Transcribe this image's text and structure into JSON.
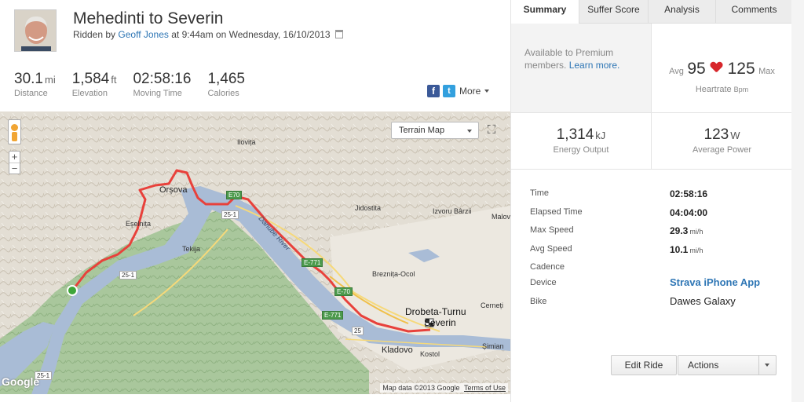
{
  "activity": {
    "title": "Mehedinti to Severin",
    "ridden_by_prefix": "Ridden by",
    "athlete_name": "Geoff Jones",
    "at_text": "at 9:44am on Wednesday, 16/10/2013"
  },
  "stats": [
    {
      "value": "30.1",
      "unit": "mi",
      "label": "Distance"
    },
    {
      "value": "1,584",
      "unit": "ft",
      "label": "Elevation"
    },
    {
      "value": "02:58:16",
      "unit": "",
      "label": "Moving Time"
    },
    {
      "value": "1,465",
      "unit": "",
      "label": "Calories"
    }
  ],
  "share": {
    "facebook_icon": "f",
    "twitter_icon": "t",
    "more_label": "More"
  },
  "map": {
    "type_select": "Terrain Map",
    "zoom_in": "+",
    "zoom_out": "−",
    "fullscreen_icon": "⛶",
    "google_logo": "Google",
    "attribution": "Map data ©2013 Google",
    "terms": "Terms of Use",
    "places": {
      "orsova": "Orșova",
      "ilovita": "Ilovița",
      "jidostita": "Jidostita",
      "izvoru_barzii": "Izvoru Bârzii",
      "malov": "Malov",
      "esenita": "Eșelnița",
      "tekija": "Tekija",
      "breznita": "Breznița-Ocol",
      "drobeta1": "Drobeta-Turnu",
      "drobeta2": "Severin",
      "cerneti": "Cerneți",
      "kladovo": "Kladovo",
      "kostol": "Kostol",
      "simian": "Șimian",
      "danube": "Danube River"
    },
    "roads": {
      "r25_1a": "25-1",
      "r25_1b": "25-1",
      "r25_1c": "25-1",
      "r25": "25",
      "e771a": "E-771",
      "e70": "E-70",
      "e771b": "E-771",
      "e70b": "E70"
    }
  },
  "tabs": [
    {
      "label": "Summary",
      "active": true
    },
    {
      "label": "Suffer Score",
      "active": false
    },
    {
      "label": "Analysis",
      "active": false
    },
    {
      "label": "Comments",
      "active": false
    }
  ],
  "premium": {
    "text": "Available to Premium members.",
    "link": "Learn more."
  },
  "heartrate": {
    "avg_label": "Avg",
    "avg": "95",
    "max": "125",
    "max_label": "Max",
    "label": "Heartrate",
    "unit": "Bpm"
  },
  "energy": {
    "value": "1,314",
    "unit": "kJ",
    "label": "Energy Output"
  },
  "power": {
    "value": "123",
    "unit": "W",
    "label": "Average Power"
  },
  "details": [
    {
      "key": "Time",
      "value": "02:58:16",
      "unit": ""
    },
    {
      "key": "Elapsed Time",
      "value": "04:04:00",
      "unit": ""
    },
    {
      "key": "Max Speed",
      "value": "29.3",
      "unit": "mi/h"
    },
    {
      "key": "Avg Speed",
      "value": "10.1",
      "unit": "mi/h"
    },
    {
      "key": "Cadence",
      "value": "",
      "unit": ""
    },
    {
      "key": "Device",
      "value": "Strava iPhone App",
      "unit": ""
    },
    {
      "key": "Bike",
      "value": "Dawes Galaxy",
      "unit": ""
    }
  ],
  "buttons": {
    "edit": "Edit Ride",
    "actions": "Actions"
  },
  "colors": {
    "route": "#e8413b",
    "link": "#2e76b5",
    "heart": "#d7262b",
    "river": "#a9bcd6",
    "forest": "#a5c79a"
  }
}
